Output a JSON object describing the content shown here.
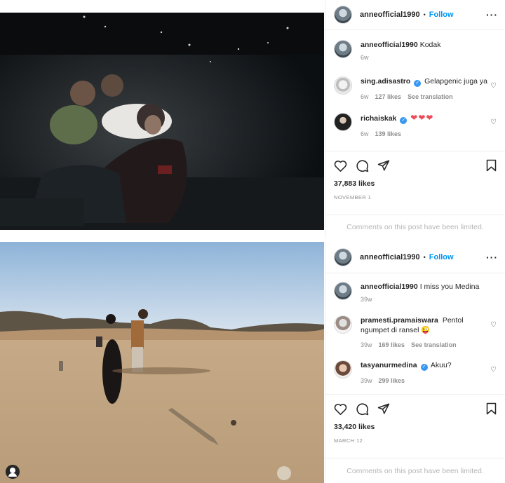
{
  "post1": {
    "header": {
      "username": "anneofficial1990",
      "separator": "•",
      "follow_label": "Follow",
      "more": "···"
    },
    "caption": {
      "username": "anneofficial1990",
      "text": "Kodak",
      "time": "6w"
    },
    "comments": [
      {
        "username": "sing.adisastro",
        "verified": true,
        "text": "Gelapgenic juga ya",
        "time": "6w",
        "likes": "127 likes",
        "translate": "See translation"
      },
      {
        "username": "richaiskak",
        "verified": true,
        "text": "❤❤❤",
        "time": "6w",
        "likes": "139 likes",
        "translate": ""
      }
    ],
    "likes": "37,883 likes",
    "date": "NOVEMBER 1",
    "limited": "Comments on this post have been limited."
  },
  "post2": {
    "header": {
      "username": "anneofficial1990",
      "separator": "•",
      "follow_label": "Follow",
      "more": "···"
    },
    "caption": {
      "username": "anneofficial1990",
      "text": "I miss you Medina",
      "time": "39w"
    },
    "comments": [
      {
        "username": "pramesti.pramaiswara",
        "verified": false,
        "text": "Pentol ngumpet di ransel 😜",
        "time": "39w",
        "likes": "169 likes",
        "translate": "See translation"
      },
      {
        "username": "tasyanurmedina",
        "verified": true,
        "text": "Akuu?",
        "time": "39w",
        "likes": "299 likes",
        "translate": ""
      }
    ],
    "likes": "33,420 likes",
    "date": "MARCH 12",
    "limited": "Comments on this post have been limited."
  },
  "icons": [
    "heart-icon",
    "comment-icon",
    "share-icon",
    "bookmark-icon",
    "more-icon",
    "verified-icon"
  ],
  "colors": {
    "follow": "#0095f6",
    "verified": "#3897f0",
    "heart_red": "#ed4956",
    "muted": "#8e8e8e"
  }
}
